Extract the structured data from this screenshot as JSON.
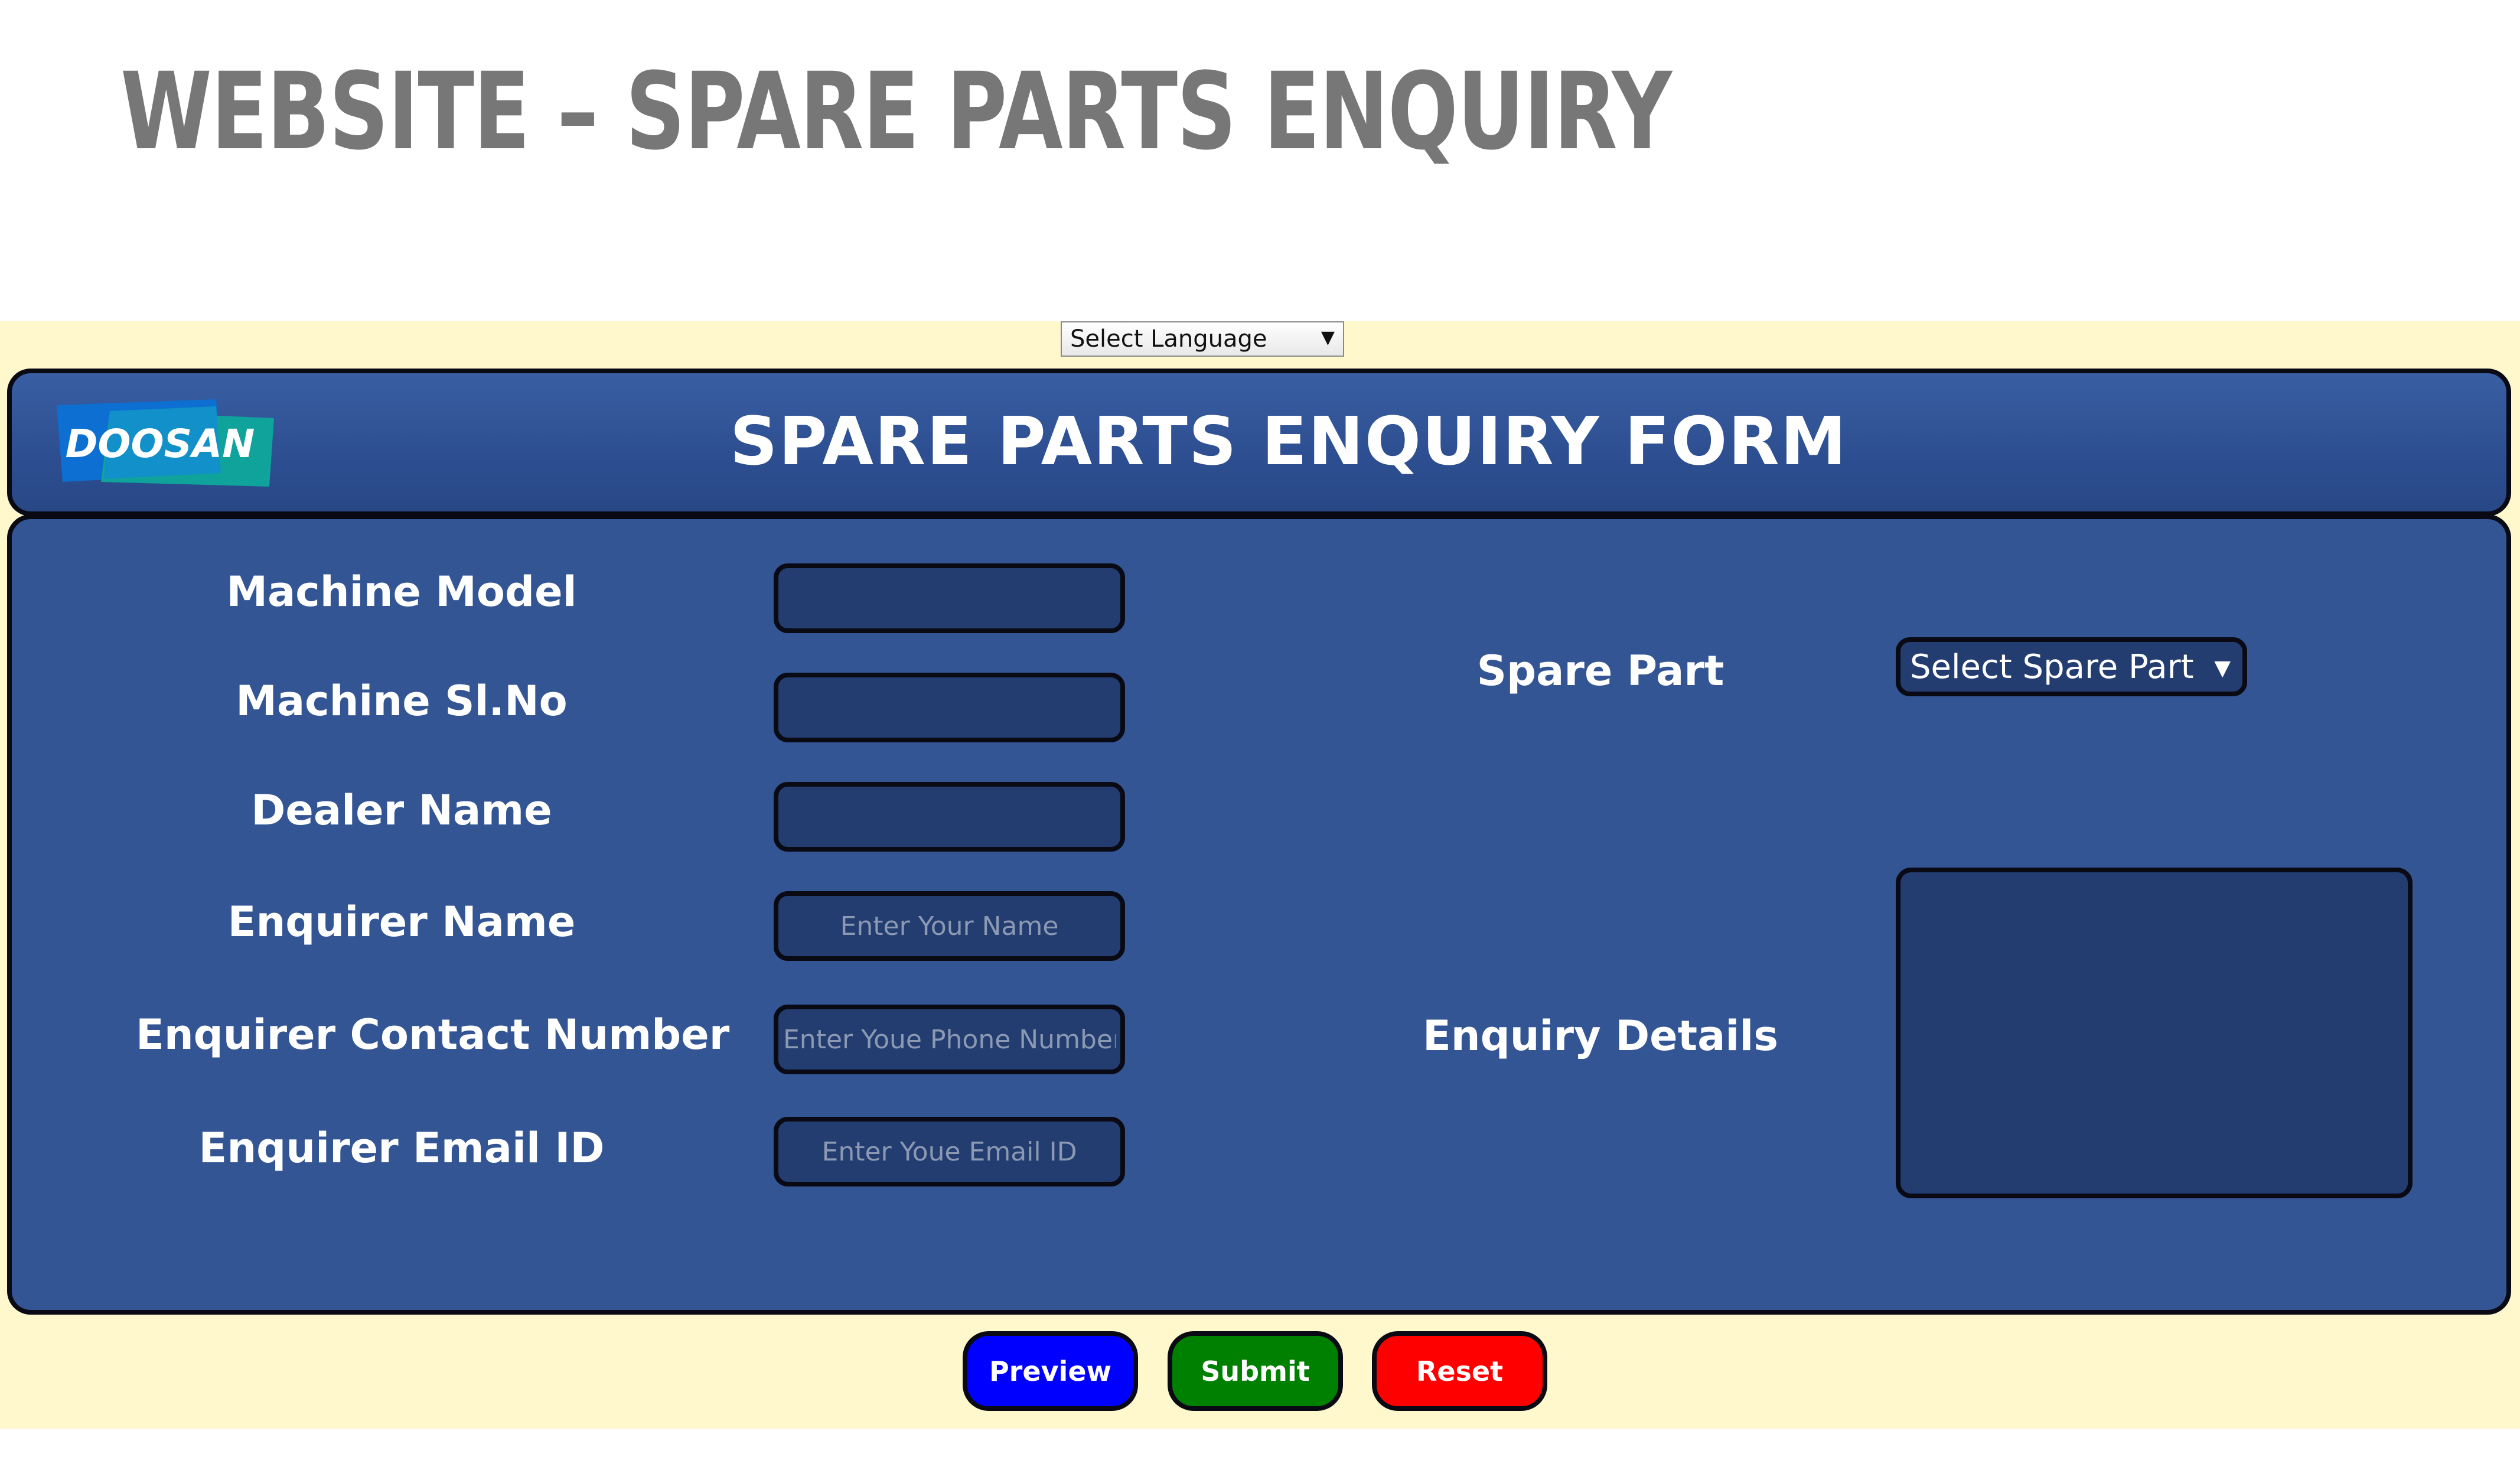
{
  "slide": {
    "title": "WEBSITE – SPARE PARTS ENQUIRY"
  },
  "language_select": {
    "selected": "Select Language"
  },
  "header": {
    "logo_text": "DOOSAN",
    "title": "SPARE PARTS ENQUIRY FORM"
  },
  "form": {
    "fields": [
      {
        "label": "Machine Model",
        "value": "",
        "placeholder": ""
      },
      {
        "label": "Machine Sl.No",
        "value": "",
        "placeholder": ""
      },
      {
        "label": "Dealer Name",
        "value": "",
        "placeholder": ""
      },
      {
        "label": "Enquirer Name",
        "value": "",
        "placeholder": "Enter Your Name"
      },
      {
        "label": "Enquirer Contact Number",
        "value": "",
        "placeholder": "Enter Youe Phone Number"
      },
      {
        "label": "Enquirer Email ID",
        "value": "",
        "placeholder": "Enter Youe Email ID"
      }
    ],
    "spare_part": {
      "label": "Spare Part",
      "selected": "Select Spare Part"
    },
    "enquiry_details": {
      "label": "Enquiry Details",
      "value": ""
    }
  },
  "buttons": {
    "preview": "Preview",
    "submit": "Submit",
    "reset": "Reset"
  },
  "colors": {
    "page_bg": "#fff8cc",
    "panel_bg": "#335594",
    "input_bg": "#233d70",
    "preview": "#0000ff",
    "submit": "#008000",
    "reset": "#ff0000",
    "logo_blue": "#0d6fd1",
    "logo_green": "#0fa39b"
  }
}
